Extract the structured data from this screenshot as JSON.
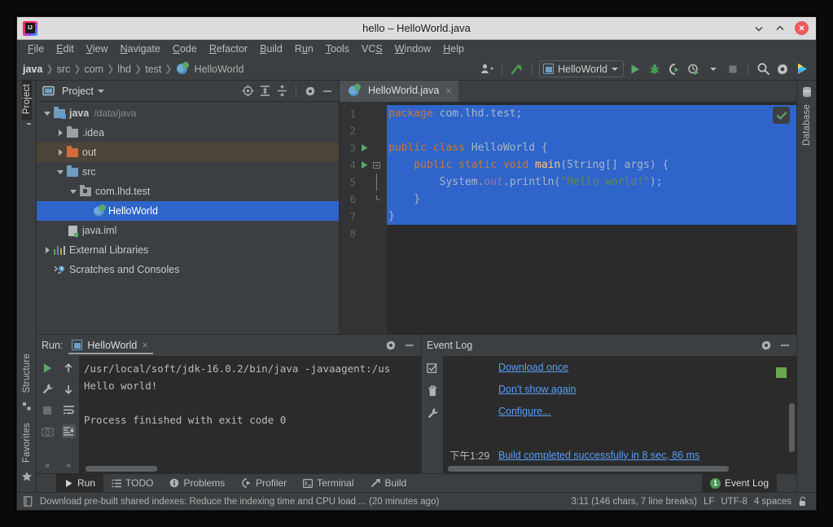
{
  "window": {
    "title": "hello – HelloWorld.java",
    "logo_icon": "intellij-idea-logo",
    "minimize_label": "Minimize",
    "maximize_label": "Maximize",
    "close_label": "Close"
  },
  "menubar": {
    "items": [
      {
        "label": "File",
        "mnemonic": "F"
      },
      {
        "label": "Edit",
        "mnemonic": "E"
      },
      {
        "label": "View",
        "mnemonic": "V"
      },
      {
        "label": "Navigate",
        "mnemonic": "N"
      },
      {
        "label": "Code",
        "mnemonic": "C"
      },
      {
        "label": "Refactor",
        "mnemonic": "R"
      },
      {
        "label": "Build",
        "mnemonic": "B"
      },
      {
        "label": "Run",
        "mnemonic": "u"
      },
      {
        "label": "Tools",
        "mnemonic": "T"
      },
      {
        "label": "VCS",
        "mnemonic": "S"
      },
      {
        "label": "Window",
        "mnemonic": "W"
      },
      {
        "label": "Help",
        "mnemonic": "H"
      }
    ]
  },
  "toolbar": {
    "breadcrumbs": [
      "java",
      "src",
      "com",
      "lhd",
      "test",
      "HelloWorld"
    ],
    "breadcrumb_icon": "java-class-icon",
    "run_config": "HelloWorld",
    "run_config_icon": "class-icon",
    "icons": [
      "user-avatar-icon",
      "update-project-icon",
      "run-icon",
      "debug-icon",
      "run-with-coverage-icon",
      "profiler-icon",
      "stop-icon",
      "search-everywhere-icon",
      "settings-gear-icon",
      "ide-features-icon"
    ]
  },
  "left_strip": {
    "top_tab": "Project",
    "top_tab_icon": "project-folder-icon",
    "bottom_tabs": [
      "Structure",
      "Favorites"
    ],
    "structure_icon": "structure-icon",
    "favorites_icon": "star-icon"
  },
  "right_strip": {
    "tab": "Database",
    "icon": "database-icon"
  },
  "project_panel": {
    "title": "Project",
    "header_icons": [
      "select-opened-file-icon",
      "expand-all-icon",
      "collapse-all-icon",
      "settings-gear-icon",
      "hide-icon"
    ],
    "tree": [
      {
        "label": "java",
        "sub": "/data/java",
        "icon": "module-folder-icon",
        "indent": 0,
        "twisty": "open",
        "state": "normal",
        "bold": true
      },
      {
        "label": ".idea",
        "sub": "",
        "icon": "folder-grey-icon",
        "indent": 1,
        "twisty": "closed",
        "state": "normal",
        "bold": false
      },
      {
        "label": "out",
        "sub": "",
        "icon": "folder-orange-icon",
        "indent": 1,
        "twisty": "closed",
        "state": "highlight",
        "bold": false
      },
      {
        "label": "src",
        "sub": "",
        "icon": "source-folder-icon",
        "indent": 1,
        "twisty": "open",
        "state": "normal",
        "bold": false
      },
      {
        "label": "com.lhd.test",
        "sub": "",
        "icon": "package-icon",
        "indent": 2,
        "twisty": "open",
        "state": "normal",
        "bold": false
      },
      {
        "label": "HelloWorld",
        "sub": "",
        "icon": "java-class-icon",
        "indent": 3,
        "twisty": "none",
        "state": "selected",
        "bold": false
      },
      {
        "label": "java.iml",
        "sub": "",
        "icon": "iml-file-icon",
        "indent": 1,
        "twisty": "none",
        "state": "normal",
        "bold": false
      },
      {
        "label": "External Libraries",
        "sub": "",
        "icon": "libraries-icon",
        "indent": 0,
        "twisty": "closed",
        "state": "normal",
        "bold": false
      },
      {
        "label": "Scratches and Consoles",
        "sub": "",
        "icon": "scratches-icon",
        "indent": 0,
        "twisty": "none",
        "state": "normal",
        "bold": false
      }
    ]
  },
  "editor": {
    "tab": {
      "label": "HelloWorld.java",
      "icon": "java-class-icon",
      "close": "×"
    },
    "inspection_badge": "checkmark-ok-icon",
    "lines": [
      {
        "n": "1",
        "run_marker": false,
        "fold": "",
        "selected": true,
        "tokens": [
          {
            "t": "package",
            "c": "kw"
          },
          {
            "t": " com.lhd.test;",
            "c": "plain"
          }
        ]
      },
      {
        "n": "2",
        "run_marker": false,
        "fold": "",
        "selected": true,
        "tokens": []
      },
      {
        "n": "3",
        "run_marker": true,
        "fold": "",
        "selected": true,
        "tokens": [
          {
            "t": "public class ",
            "c": "kw"
          },
          {
            "t": "HelloWorld {",
            "c": "plain"
          }
        ]
      },
      {
        "n": "4",
        "run_marker": true,
        "fold": "minus",
        "selected": true,
        "tokens": [
          {
            "t": "    public static void ",
            "c": "kw"
          },
          {
            "t": "main",
            "c": "fnm"
          },
          {
            "t": "(String[] args) {",
            "c": "plain"
          }
        ]
      },
      {
        "n": "5",
        "run_marker": false,
        "fold": "",
        "selected": true,
        "tokens": [
          {
            "t": "        System.",
            "c": "plain"
          },
          {
            "t": "out",
            "c": "fld2"
          },
          {
            "t": ".println(",
            "c": "plain"
          },
          {
            "t": "\"Hello world!\"",
            "c": "str"
          },
          {
            "t": ");",
            "c": "plain"
          }
        ]
      },
      {
        "n": "6",
        "run_marker": false,
        "fold": "end",
        "selected": true,
        "tokens": [
          {
            "t": "    }",
            "c": "plain"
          }
        ]
      },
      {
        "n": "7",
        "run_marker": false,
        "fold": "",
        "selected": true,
        "tokens": [
          {
            "t": "}",
            "c": "plain"
          }
        ]
      },
      {
        "n": "8",
        "run_marker": false,
        "fold": "",
        "selected": false,
        "tokens": []
      }
    ]
  },
  "run_panel": {
    "title": "Run:",
    "tab_label": "HelloWorld",
    "tab_icon": "class-icon",
    "tab_close": "×",
    "header_icons": [
      "settings-gear-icon",
      "hide-icon"
    ],
    "left_icons": [
      "rerun-icon",
      "edit-configuration-icon",
      "stop-icon",
      "screenshot-icon",
      "more-icon"
    ],
    "right_icons": [
      "up-arrow-icon",
      "down-arrow-icon",
      "soft-wrap-icon",
      "scroll-to-end-icon",
      "more-icon"
    ],
    "console": [
      "/usr/local/soft/jdk-16.0.2/bin/java -javaagent:/us",
      "Hello world!",
      "",
      "Process finished with exit code 0"
    ]
  },
  "event_log": {
    "title": "Event Log",
    "header_icons": [
      "settings-gear-icon",
      "hide-icon"
    ],
    "left_icons": [
      "mark-read-icon",
      "trash-icon",
      "wrench-icon"
    ],
    "entries": [
      {
        "time": "",
        "text": "Download once",
        "link": true
      },
      {
        "time": "",
        "text": "Don't show again",
        "link": true
      },
      {
        "time": "",
        "text": "Configure...",
        "link": true
      },
      {
        "time": "",
        "text": "",
        "link": false
      },
      {
        "time": "下午1:29",
        "text": "Build completed successfully in 8 sec, 86 ms",
        "link": true
      }
    ]
  },
  "tool_window_tabs": {
    "left": [
      {
        "label": "Run",
        "icon": "run-icon",
        "active": true
      },
      {
        "label": "TODO",
        "icon": "todo-icon",
        "active": false
      },
      {
        "label": "Problems",
        "icon": "problems-icon",
        "active": false
      },
      {
        "label": "Profiler",
        "icon": "profiler-icon",
        "active": false
      },
      {
        "label": "Terminal",
        "icon": "terminal-icon",
        "active": false
      },
      {
        "label": "Build",
        "icon": "build-icon",
        "active": false
      }
    ],
    "right": {
      "label": "Event Log",
      "badge": "1",
      "active": true
    }
  },
  "statusbar": {
    "icon": "notification-icon",
    "message": "Download pre-built shared indexes: Reduce the indexing time and CPU load ... (20 minutes ago)",
    "caret": "3:11 (146 chars, 7 line breaks)",
    "line_separator": "LF",
    "encoding": "UTF-8",
    "indent": "4 spaces",
    "lock_icon": "unlocked-icon"
  },
  "colors": {
    "frame": "#3c3f41",
    "editor_bg": "#2b2b2b",
    "selection": "#2f65ca",
    "accent_green": "#59a869",
    "link": "#589df6",
    "keyword": "#cc7832",
    "string": "#6a8759",
    "close_red": "#ea5b5b"
  }
}
